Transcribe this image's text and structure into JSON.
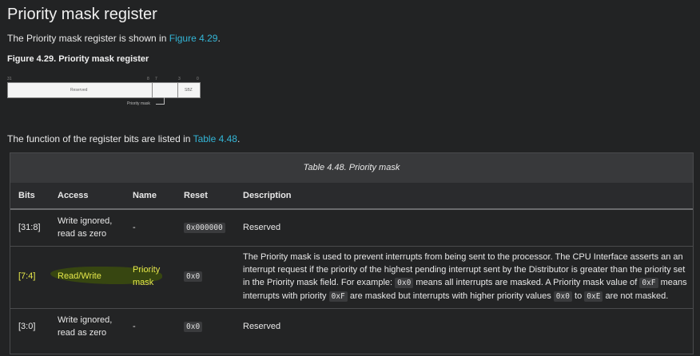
{
  "heading": "Priority mask register",
  "intro": {
    "text": "The Priority mask register is shown in ",
    "link": "Figure 4.29",
    "end": "."
  },
  "figure": {
    "caption": "Figure 4.29. Priority mask register",
    "bits": [
      "31",
      "8",
      "7",
      "3",
      "0"
    ],
    "field_reserved": "Reserved",
    "field_sbz": "SBZ",
    "label_priority_mask": "Priority mask"
  },
  "outro": {
    "text": "The function of the register bits are listed in ",
    "link": "Table 4.48",
    "end": "."
  },
  "table": {
    "caption": "Table 4.48. Priority mask",
    "headers": [
      "Bits",
      "Access",
      "Name",
      "Reset",
      "Description"
    ],
    "rows": [
      {
        "bits": "[31:8]",
        "access": "Write ignored, read as zero",
        "name": "-",
        "reset": "0x000000",
        "description": "Reserved"
      },
      {
        "bits": "[7:4]",
        "access": "Read/Write",
        "name": "Priority mask",
        "reset": "0x0",
        "description_parts": [
          "The Priority mask is used to prevent interrupts from being sent to the processor. The CPU Interface asserts an an interrupt request if the priority of the highest pending interrupt sent by the Distributor is greater than the priority set in the Priority mask field. For example: ",
          "0x0",
          " means all interrupts are masked. A Priority mask value of ",
          "0xF",
          " means interrupts with priority ",
          "0xF",
          " are masked but interrupts with higher priority values ",
          "0x0",
          " to ",
          "0xE",
          " are not masked."
        ]
      },
      {
        "bits": "[3:0]",
        "access": "Write ignored, read as zero",
        "name": "-",
        "reset": "0x0",
        "description": "Reserved"
      }
    ]
  }
}
